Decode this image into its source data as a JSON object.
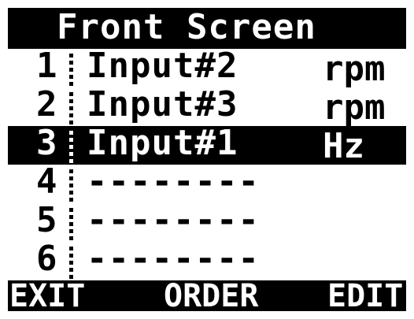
{
  "title": "Front Screen",
  "items": [
    {
      "num": "1",
      "name": "Input#2",
      "unit": "rpm",
      "selected": false
    },
    {
      "num": "2",
      "name": "Input#3",
      "unit": "rpm",
      "selected": false
    },
    {
      "num": "3",
      "name": "Input#1",
      "unit": "Hz",
      "selected": true
    },
    {
      "num": "4",
      "name": "--------",
      "unit": "",
      "selected": false
    },
    {
      "num": "5",
      "name": "--------",
      "unit": "",
      "selected": false
    },
    {
      "num": "6",
      "name": "--------",
      "unit": "",
      "selected": false
    }
  ],
  "softkeys": {
    "exit": "EXIT",
    "order": "ORDER",
    "edit": "EDIT"
  },
  "colors": {
    "background": "#000000",
    "foreground": "#ffffff",
    "list_background": "#ffffff"
  }
}
